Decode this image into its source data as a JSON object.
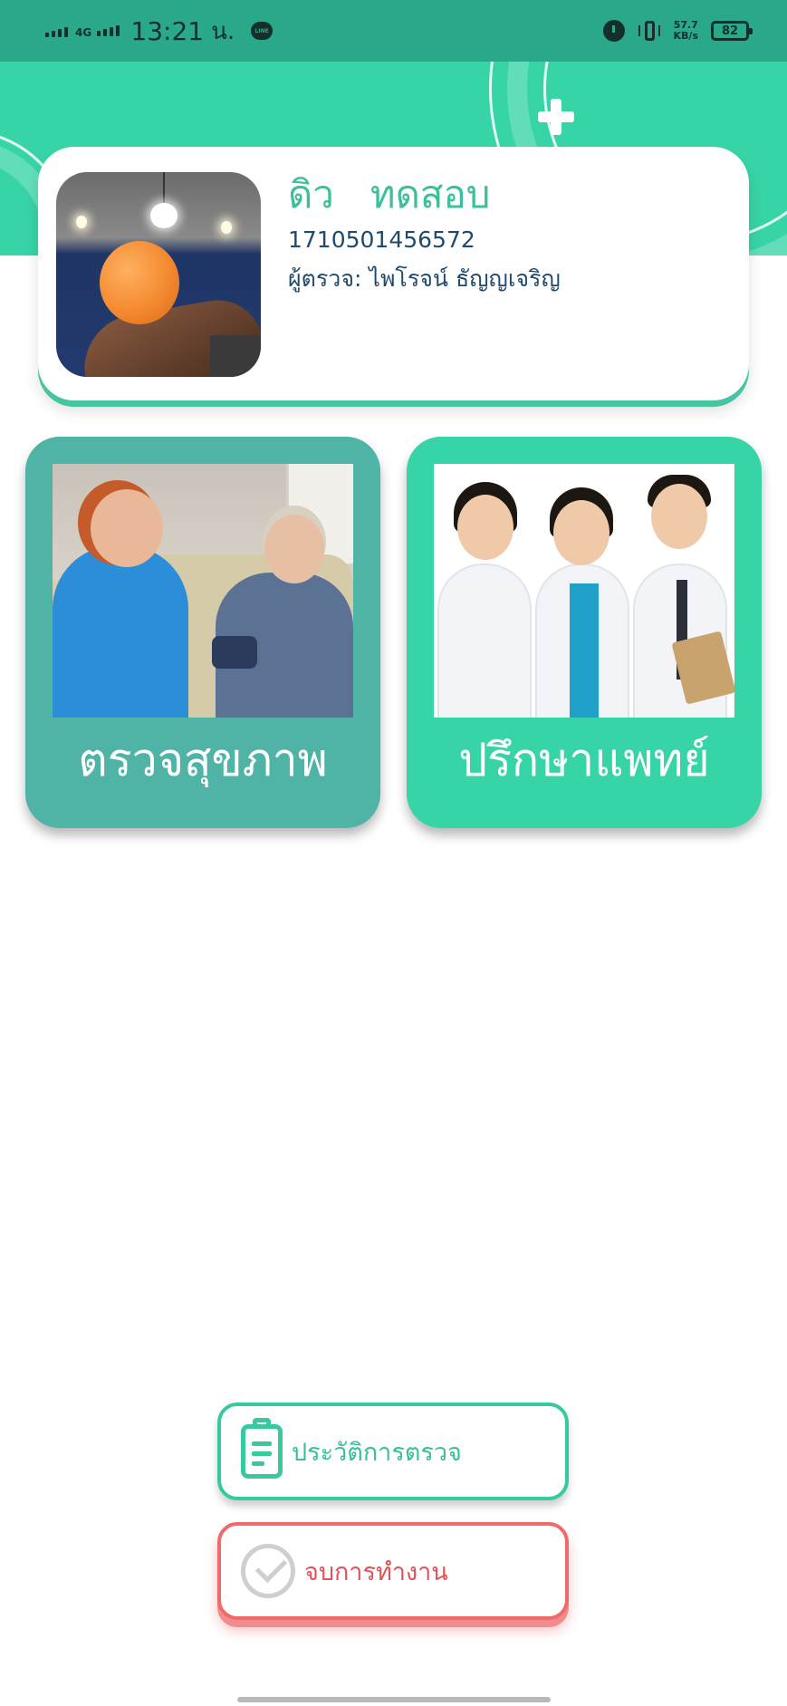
{
  "status_bar": {
    "network": "4G",
    "time": "13:21",
    "time_suffix": "น.",
    "line_badge": "LINE",
    "speed_value": "57.7",
    "speed_unit": "KB/s",
    "battery": "82",
    "icons": [
      "signal-icon",
      "signal-4g-icon",
      "line-app-icon",
      "alarm-icon",
      "vibrate-icon",
      "battery-icon"
    ]
  },
  "profile": {
    "name": "ดิว   ทดสอบ",
    "id_number": "1710501456572",
    "inspector": "ผู้ตรวจ: ไพโรจน์ ธัญญเจริญ"
  },
  "menu": {
    "health_check": {
      "label": "ตรวจสุขภาพ"
    },
    "consult_doctor": {
      "label": "ปรึกษาแพทย์"
    }
  },
  "actions": {
    "history": {
      "label": "ประวัติการตรวจ",
      "icon": "clipboard-icon"
    },
    "finish": {
      "label": "จบการทำงาน",
      "icon": "check-circle-icon"
    }
  },
  "colors": {
    "status_bar": "#2aa88a",
    "header": "#37d4a7",
    "tile_health": "#4fb3a5",
    "tile_doctor": "#37d4a7",
    "history_border": "#37c9a0",
    "finish_border": "#f06a6a"
  }
}
